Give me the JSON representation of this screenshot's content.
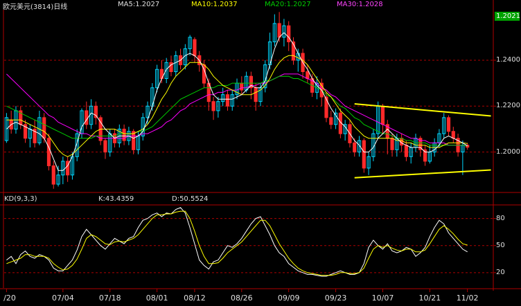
{
  "header": {
    "title": "欧元美元(3814)日线",
    "ma5": "MA5:1.2027",
    "ma10": "MA10:1.2037",
    "ma20": "MA20:1.2027",
    "ma30": "MA30:1.2028",
    "last_price": "1.2021"
  },
  "kd_header": {
    "label": "KD(9,3,3)",
    "k": "K:43.4359",
    "d": "D:50.5524"
  },
  "colors": {
    "up": "#00d8ff",
    "down": "#ff2a2a",
    "ma5": "#ffffff",
    "ma10": "#ffff00",
    "ma20": "#00cc00",
    "ma30": "#ff00ff",
    "trendline": "#ffff00",
    "grid": "#b00000"
  },
  "chart_data": [
    {
      "type": "candlestick",
      "title": "欧元美元(3814)日线",
      "instrument": "EUR/USD",
      "ylim": [
        1.183,
        1.262
      ],
      "y_ticks": [
        1.2,
        1.22,
        1.24
      ],
      "y_tick_labels": [
        "1.2000",
        "1.2200",
        "1.2400"
      ],
      "x_tick_labels": [
        "/20",
        "07/04",
        "07/18",
        "08/01",
        "08/12",
        "08/26",
        "09/09",
        "09/23",
        "10/07",
        "10/21",
        "11/02"
      ],
      "x_tick_index": [
        0,
        12,
        22,
        32,
        40,
        50,
        60,
        70,
        80,
        90,
        98
      ],
      "candles": [
        [
          1.205,
          1.215,
          1.217,
          1.204
        ],
        [
          1.214,
          1.21,
          1.218,
          1.208
        ],
        [
          1.21,
          1.218,
          1.22,
          1.208
        ],
        [
          1.218,
          1.212,
          1.22,
          1.21
        ],
        [
          1.212,
          1.206,
          1.214,
          1.204
        ],
        [
          1.206,
          1.21,
          1.212,
          1.202
        ],
        [
          1.21,
          1.204,
          1.214,
          1.202
        ],
        [
          1.204,
          1.215,
          1.218,
          1.203
        ],
        [
          1.215,
          1.206,
          1.217,
          1.204
        ],
        [
          1.206,
          1.194,
          1.208,
          1.192
        ],
        [
          1.194,
          1.186,
          1.196,
          1.184
        ],
        [
          1.186,
          1.19,
          1.194,
          1.185
        ],
        [
          1.19,
          1.196,
          1.198,
          1.186
        ],
        [
          1.196,
          1.19,
          1.198,
          1.187
        ],
        [
          1.19,
          1.198,
          1.2,
          1.188
        ],
        [
          1.198,
          1.208,
          1.21,
          1.196
        ],
        [
          1.208,
          1.218,
          1.219,
          1.206
        ],
        [
          1.218,
          1.212,
          1.222,
          1.21
        ],
        [
          1.212,
          1.22,
          1.223,
          1.21
        ],
        [
          1.22,
          1.215,
          1.222,
          1.212
        ],
        [
          1.215,
          1.205,
          1.216,
          1.203
        ],
        [
          1.205,
          1.2,
          1.206,
          1.197
        ],
        [
          1.2,
          1.208,
          1.21,
          1.198
        ],
        [
          1.208,
          1.204,
          1.21,
          1.202
        ],
        [
          1.204,
          1.21,
          1.212,
          1.202
        ],
        [
          1.21,
          1.205,
          1.212,
          1.203
        ],
        [
          1.205,
          1.209,
          1.211,
          1.203
        ],
        [
          1.209,
          1.201,
          1.21,
          1.199
        ],
        [
          1.201,
          1.207,
          1.209,
          1.199
        ],
        [
          1.207,
          1.215,
          1.217,
          1.205
        ],
        [
          1.215,
          1.22,
          1.222,
          1.212
        ],
        [
          1.22,
          1.228,
          1.23,
          1.218
        ],
        [
          1.228,
          1.236,
          1.238,
          1.226
        ],
        [
          1.236,
          1.232,
          1.24,
          1.23
        ],
        [
          1.232,
          1.239,
          1.241,
          1.23
        ],
        [
          1.239,
          1.235,
          1.242,
          1.233
        ],
        [
          1.235,
          1.242,
          1.244,
          1.233
        ],
        [
          1.242,
          1.238,
          1.245,
          1.236
        ],
        [
          1.238,
          1.245,
          1.247,
          1.236
        ],
        [
          1.245,
          1.25,
          1.251,
          1.242
        ],
        [
          1.249,
          1.242,
          1.25,
          1.239
        ],
        [
          1.242,
          1.238,
          1.244,
          1.235
        ],
        [
          1.238,
          1.23,
          1.24,
          1.228
        ],
        [
          1.23,
          1.222,
          1.232,
          1.218
        ],
        [
          1.222,
          1.218,
          1.224,
          1.214
        ],
        [
          1.218,
          1.222,
          1.224,
          1.215
        ],
        [
          1.222,
          1.225,
          1.228,
          1.22
        ],
        [
          1.225,
          1.22,
          1.227,
          1.218
        ],
        [
          1.22,
          1.225,
          1.227,
          1.218
        ],
        [
          1.225,
          1.23,
          1.232,
          1.223
        ],
        [
          1.23,
          1.227,
          1.233,
          1.225
        ],
        [
          1.227,
          1.233,
          1.235,
          1.226
        ],
        [
          1.233,
          1.228,
          1.235,
          1.223
        ],
        [
          1.228,
          1.222,
          1.23,
          1.218
        ],
        [
          1.222,
          1.228,
          1.23,
          1.22
        ],
        [
          1.228,
          1.238,
          1.24,
          1.226
        ],
        [
          1.238,
          1.248,
          1.252,
          1.236
        ],
        [
          1.248,
          1.256,
          1.26,
          1.246
        ],
        [
          1.256,
          1.25,
          1.261,
          1.248
        ],
        [
          1.25,
          1.255,
          1.258,
          1.246
        ],
        [
          1.255,
          1.248,
          1.257,
          1.244
        ],
        [
          1.248,
          1.24,
          1.25,
          1.238
        ],
        [
          1.24,
          1.243,
          1.245,
          1.235
        ],
        [
          1.243,
          1.235,
          1.245,
          1.232
        ],
        [
          1.235,
          1.232,
          1.238,
          1.23
        ],
        [
          1.232,
          1.226,
          1.234,
          1.224
        ],
        [
          1.226,
          1.23,
          1.233,
          1.223
        ],
        [
          1.23,
          1.224,
          1.232,
          1.22
        ],
        [
          1.224,
          1.215,
          1.226,
          1.213
        ],
        [
          1.215,
          1.212,
          1.218,
          1.21
        ],
        [
          1.212,
          1.217,
          1.219,
          1.21
        ],
        [
          1.217,
          1.208,
          1.219,
          1.206
        ],
        [
          1.208,
          1.212,
          1.214,
          1.205
        ],
        [
          1.212,
          1.204,
          1.214,
          1.202
        ],
        [
          1.204,
          1.2,
          1.206,
          1.198
        ],
        [
          1.2,
          1.205,
          1.207,
          1.198
        ],
        [
          1.205,
          1.193,
          1.206,
          1.191
        ],
        [
          1.193,
          1.198,
          1.2,
          1.19
        ],
        [
          1.198,
          1.208,
          1.21,
          1.196
        ],
        [
          1.208,
          1.22,
          1.222,
          1.206
        ],
        [
          1.22,
          1.212,
          1.221,
          1.208
        ],
        [
          1.212,
          1.206,
          1.214,
          1.199
        ],
        [
          1.206,
          1.201,
          1.208,
          1.198
        ],
        [
          1.201,
          1.206,
          1.208,
          1.198
        ],
        [
          1.206,
          1.203,
          1.208,
          1.2
        ],
        [
          1.203,
          1.198,
          1.205,
          1.196
        ],
        [
          1.198,
          1.202,
          1.204,
          1.195
        ],
        [
          1.202,
          1.206,
          1.208,
          1.2
        ],
        [
          1.206,
          1.201,
          1.207,
          1.198
        ],
        [
          1.201,
          1.196,
          1.203,
          1.194
        ],
        [
          1.196,
          1.2,
          1.203,
          1.195
        ],
        [
          1.2,
          1.204,
          1.206,
          1.198
        ],
        [
          1.204,
          1.208,
          1.21,
          1.202
        ],
        [
          1.208,
          1.215,
          1.217,
          1.206
        ],
        [
          1.215,
          1.209,
          1.216,
          1.207
        ],
        [
          1.209,
          1.206,
          1.211,
          1.204
        ],
        [
          1.206,
          1.2,
          1.208,
          1.198
        ],
        [
          1.2,
          1.203,
          1.205,
          1.19
        ],
        [
          1.203,
          1.2021,
          1.204,
          1.201
        ]
      ],
      "ma5": [
        1.21,
        1.212,
        1.213,
        1.212,
        1.211,
        1.21,
        1.209,
        1.208,
        1.206,
        1.202,
        1.197,
        1.192,
        1.192,
        1.194,
        1.198,
        1.204,
        1.211,
        1.214,
        1.217,
        1.216,
        1.213,
        1.21,
        1.208,
        1.206,
        1.207,
        1.207,
        1.207,
        1.206,
        1.207,
        1.209,
        1.214,
        1.22,
        1.227,
        1.232,
        1.236,
        1.238,
        1.239,
        1.24,
        1.242,
        1.243,
        1.242,
        1.24,
        1.236,
        1.23,
        1.225,
        1.223,
        1.223,
        1.223,
        1.223,
        1.224,
        1.225,
        1.227,
        1.229,
        1.228,
        1.228,
        1.231,
        1.238,
        1.245,
        1.25,
        1.252,
        1.25,
        1.247,
        1.243,
        1.239,
        1.236,
        1.232,
        1.229,
        1.227,
        1.223,
        1.219,
        1.216,
        1.213,
        1.211,
        1.208,
        1.205,
        1.203,
        1.2,
        1.2,
        1.202,
        1.206,
        1.208,
        1.21,
        1.208,
        1.206,
        1.204,
        1.203,
        1.202,
        1.202,
        1.202,
        1.2,
        1.2,
        1.201,
        1.203,
        1.206,
        1.207,
        1.206,
        1.205,
        1.204,
        1.2027
      ],
      "ma10": [
        1.214,
        1.214,
        1.214,
        1.214,
        1.213,
        1.212,
        1.211,
        1.21,
        1.209,
        1.207,
        1.204,
        1.201,
        1.199,
        1.198,
        1.199,
        1.201,
        1.203,
        1.205,
        1.207,
        1.209,
        1.21,
        1.21,
        1.21,
        1.21,
        1.209,
        1.208,
        1.208,
        1.208,
        1.209,
        1.21,
        1.212,
        1.215,
        1.219,
        1.223,
        1.226,
        1.23,
        1.233,
        1.235,
        1.237,
        1.239,
        1.239,
        1.239,
        1.238,
        1.236,
        1.233,
        1.231,
        1.229,
        1.228,
        1.227,
        1.226,
        1.225,
        1.225,
        1.225,
        1.226,
        1.227,
        1.229,
        1.232,
        1.236,
        1.239,
        1.241,
        1.242,
        1.242,
        1.241,
        1.24,
        1.238,
        1.235,
        1.232,
        1.229,
        1.226,
        1.224,
        1.221,
        1.218,
        1.216,
        1.214,
        1.211,
        1.209,
        1.207,
        1.206,
        1.206,
        1.206,
        1.206,
        1.206,
        1.206,
        1.205,
        1.205,
        1.204,
        1.204,
        1.203,
        1.203,
        1.203,
        1.202,
        1.202,
        1.202,
        1.203,
        1.204,
        1.204,
        1.204,
        1.204,
        1.2037
      ],
      "ma20": [
        1.22,
        1.219,
        1.218,
        1.217,
        1.216,
        1.215,
        1.214,
        1.213,
        1.212,
        1.211,
        1.21,
        1.209,
        1.208,
        1.207,
        1.206,
        1.206,
        1.206,
        1.206,
        1.206,
        1.207,
        1.207,
        1.207,
        1.207,
        1.207,
        1.208,
        1.208,
        1.208,
        1.208,
        1.209,
        1.209,
        1.21,
        1.211,
        1.213,
        1.215,
        1.217,
        1.219,
        1.221,
        1.223,
        1.224,
        1.225,
        1.226,
        1.227,
        1.228,
        1.228,
        1.228,
        1.229,
        1.229,
        1.229,
        1.23,
        1.23,
        1.23,
        1.23,
        1.23,
        1.23,
        1.23,
        1.231,
        1.231,
        1.232,
        1.233,
        1.233,
        1.233,
        1.232,
        1.232,
        1.231,
        1.23,
        1.229,
        1.228,
        1.227,
        1.225,
        1.224,
        1.222,
        1.22,
        1.219,
        1.217,
        1.215,
        1.214,
        1.212,
        1.211,
        1.21,
        1.209,
        1.208,
        1.208,
        1.207,
        1.206,
        1.206,
        1.205,
        1.205,
        1.204,
        1.204,
        1.204,
        1.203,
        1.203,
        1.203,
        1.203,
        1.203,
        1.203,
        1.203,
        1.203,
        1.2027
      ],
      "ma30": [
        1.234,
        1.232,
        1.23,
        1.228,
        1.226,
        1.224,
        1.222,
        1.22,
        1.218,
        1.216,
        1.215,
        1.213,
        1.212,
        1.211,
        1.21,
        1.209,
        1.208,
        1.208,
        1.207,
        1.207,
        1.206,
        1.206,
        1.206,
        1.206,
        1.206,
        1.206,
        1.207,
        1.207,
        1.207,
        1.208,
        1.208,
        1.209,
        1.21,
        1.211,
        1.213,
        1.214,
        1.216,
        1.218,
        1.219,
        1.221,
        1.222,
        1.223,
        1.224,
        1.225,
        1.225,
        1.226,
        1.226,
        1.227,
        1.227,
        1.227,
        1.228,
        1.228,
        1.229,
        1.229,
        1.23,
        1.23,
        1.231,
        1.232,
        1.233,
        1.234,
        1.234,
        1.234,
        1.234,
        1.233,
        1.232,
        1.231,
        1.23,
        1.228,
        1.227,
        1.225,
        1.224,
        1.222,
        1.22,
        1.219,
        1.218,
        1.217,
        1.216,
        1.215,
        1.214,
        1.213,
        1.212,
        1.211,
        1.21,
        1.209,
        1.208,
        1.207,
        1.206,
        1.206,
        1.205,
        1.205,
        1.204,
        1.204,
        1.204,
        1.204,
        1.203,
        1.203,
        1.203,
        1.203,
        1.2028
      ],
      "trendlines": [
        {
          "from": [
            74,
            1.221
          ],
          "to": [
            103,
            1.2157
          ]
        },
        {
          "from": [
            74,
            1.1888
          ],
          "to": [
            103,
            1.1922
          ]
        }
      ]
    },
    {
      "type": "line",
      "title": "KD(9,3,3)",
      "ylim": [
        3,
        95
      ],
      "y_ticks": [
        20,
        50,
        80
      ],
      "y_tick_labels": [
        "20",
        "50",
        "80"
      ],
      "series": [
        {
          "name": "K",
          "values": [
            34,
            38,
            30,
            40,
            44,
            38,
            36,
            40,
            38,
            34,
            25,
            22,
            22,
            28,
            34,
            45,
            60,
            68,
            62,
            56,
            50,
            46,
            52,
            58,
            55,
            52,
            58,
            60,
            70,
            78,
            80,
            84,
            86,
            82,
            86,
            85,
            90,
            92,
            86,
            70,
            52,
            34,
            28,
            24,
            32,
            34,
            42,
            50,
            48,
            52,
            58,
            66,
            74,
            80,
            82,
            72,
            62,
            50,
            42,
            38,
            30,
            26,
            22,
            20,
            18,
            18,
            17,
            16,
            16,
            18,
            20,
            22,
            20,
            18,
            18,
            20,
            30,
            48,
            56,
            50,
            46,
            52,
            44,
            42,
            44,
            48,
            46,
            38,
            42,
            48,
            60,
            70,
            78,
            74,
            64,
            58,
            52,
            46,
            43
          ]
        },
        {
          "name": "D",
          "values": [
            30,
            32,
            34,
            36,
            40,
            40,
            38,
            38,
            38,
            36,
            30,
            26,
            23,
            24,
            28,
            35,
            46,
            58,
            62,
            60,
            56,
            52,
            51,
            54,
            55,
            54,
            56,
            58,
            62,
            68,
            74,
            80,
            84,
            84,
            85,
            85,
            87,
            88,
            88,
            80,
            66,
            50,
            38,
            30,
            30,
            31,
            36,
            42,
            46,
            50,
            54,
            60,
            66,
            72,
            78,
            78,
            72,
            62,
            52,
            44,
            36,
            30,
            25,
            22,
            20,
            19,
            18,
            17,
            17,
            17,
            18,
            20,
            20,
            19,
            19,
            20,
            25,
            36,
            46,
            50,
            48,
            50,
            47,
            45,
            44,
            46,
            46,
            43,
            43,
            45,
            52,
            60,
            68,
            72,
            68,
            63,
            57,
            52,
            50.5
          ]
        }
      ]
    }
  ]
}
